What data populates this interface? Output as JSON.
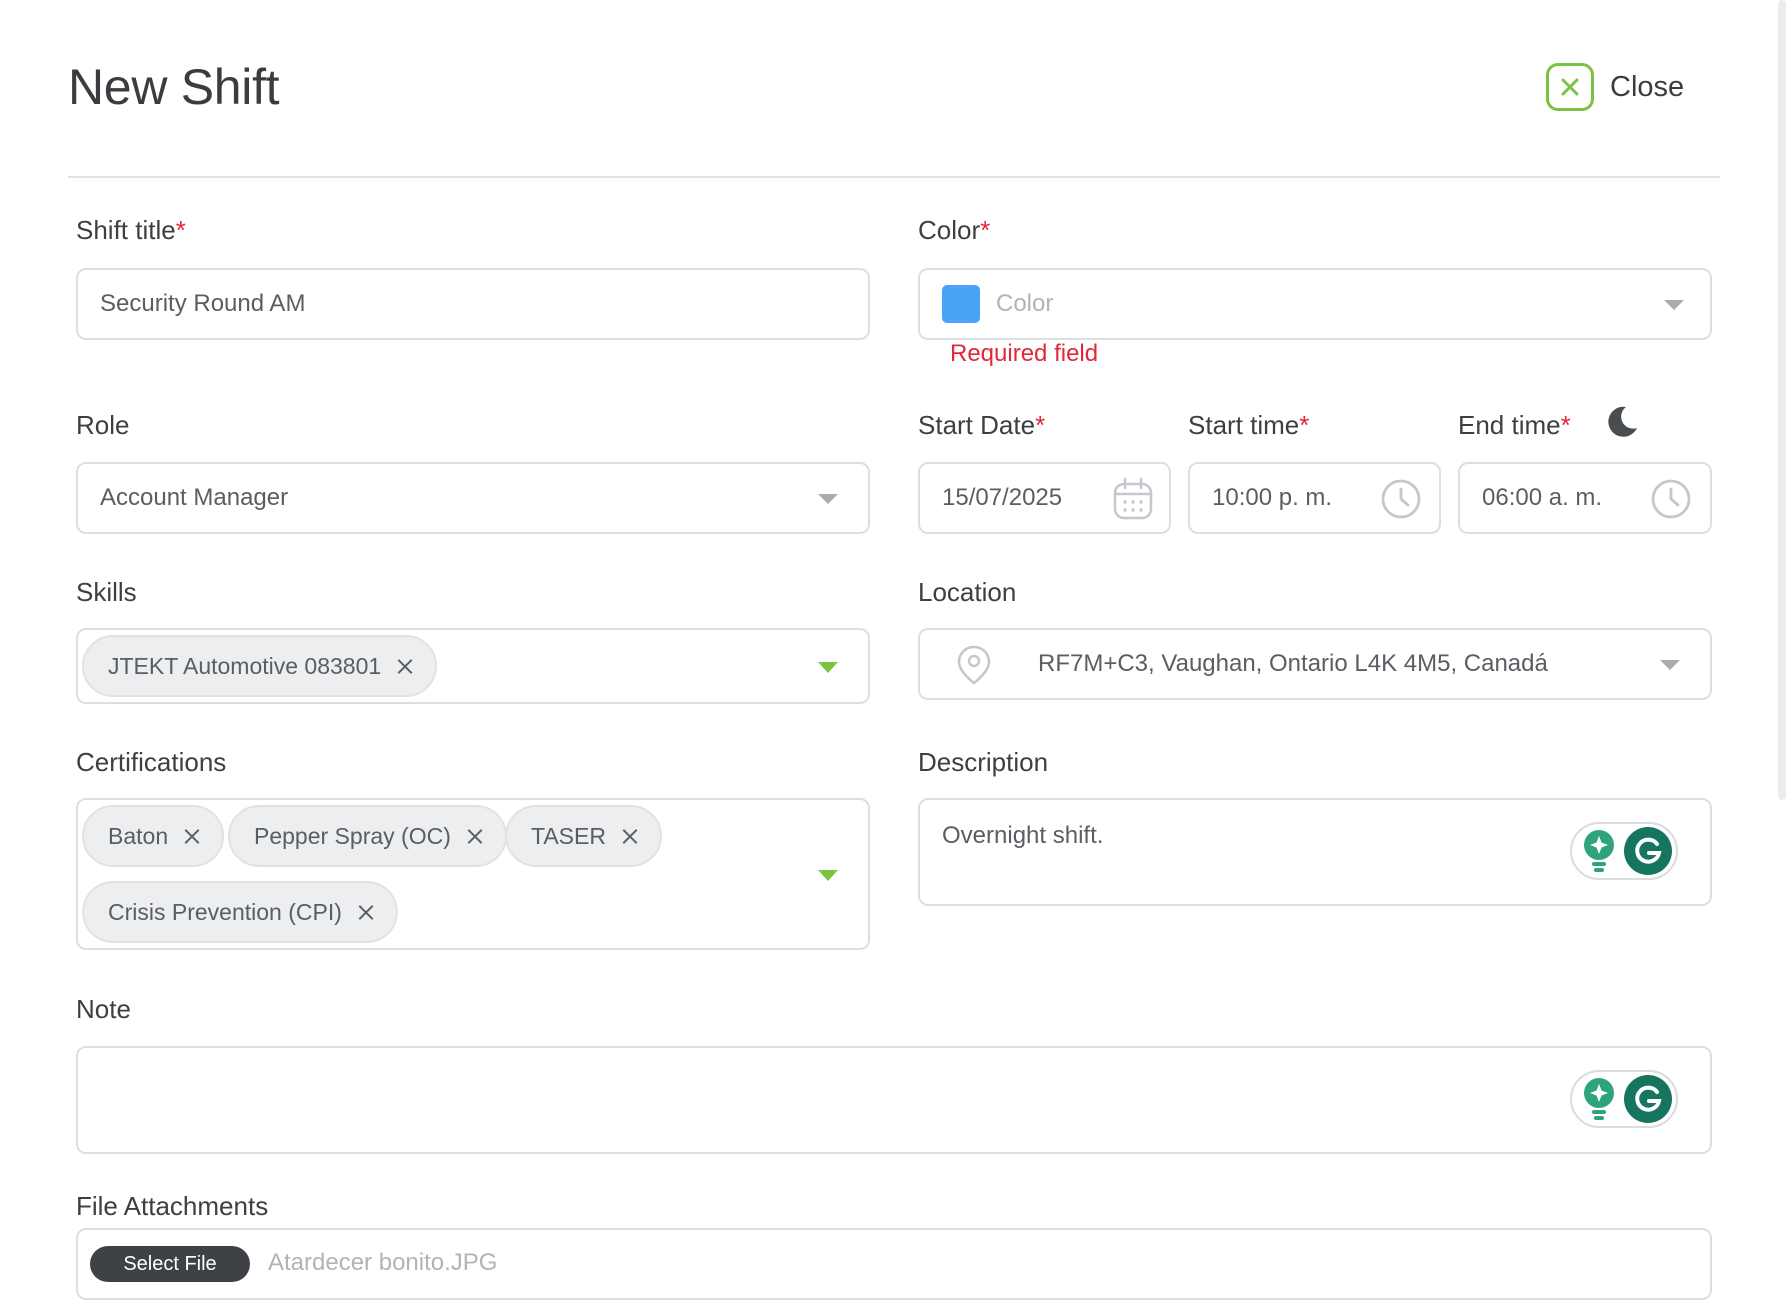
{
  "header": {
    "title": "New Shift",
    "close_label": "Close"
  },
  "form": {
    "shift_title": {
      "label": "Shift title",
      "required_mark": "*",
      "value": "Security Round AM"
    },
    "color": {
      "label": "Color",
      "required_mark": "*",
      "placeholder": "Color",
      "swatch_color": "#4aa3f6",
      "error": "Required field"
    },
    "role": {
      "label": "Role",
      "value": "Account Manager"
    },
    "start_date": {
      "label": "Start Date",
      "required_mark": "*",
      "value": "15/07/2025"
    },
    "start_time": {
      "label": "Start time",
      "required_mark": "*",
      "value": "10:00 p. m."
    },
    "end_time": {
      "label": "End time",
      "required_mark": "*",
      "value": "06:00 a. m.",
      "overnight_icon": "moon-icon"
    },
    "skills": {
      "label": "Skills",
      "chips": [
        "JTEKT Automotive 083801"
      ]
    },
    "location": {
      "label": "Location",
      "value": "RF7M+C3, Vaughan, Ontario L4K 4M5, Canadá"
    },
    "certifications": {
      "label": "Certifications",
      "chips": [
        "Baton",
        "Pepper Spray (OC)",
        "TASER",
        "Crisis Prevention (CPI)"
      ]
    },
    "description": {
      "label": "Description",
      "value": "Overnight shift."
    },
    "note": {
      "label": "Note",
      "value": ""
    },
    "attachments": {
      "label": "File Attachments",
      "button_label": "Select File",
      "file_name": "Atardecer bonito.JPG"
    }
  },
  "colors": {
    "accent": "#7cc242",
    "required": "#e0283a",
    "grammarly": "#15755e"
  }
}
